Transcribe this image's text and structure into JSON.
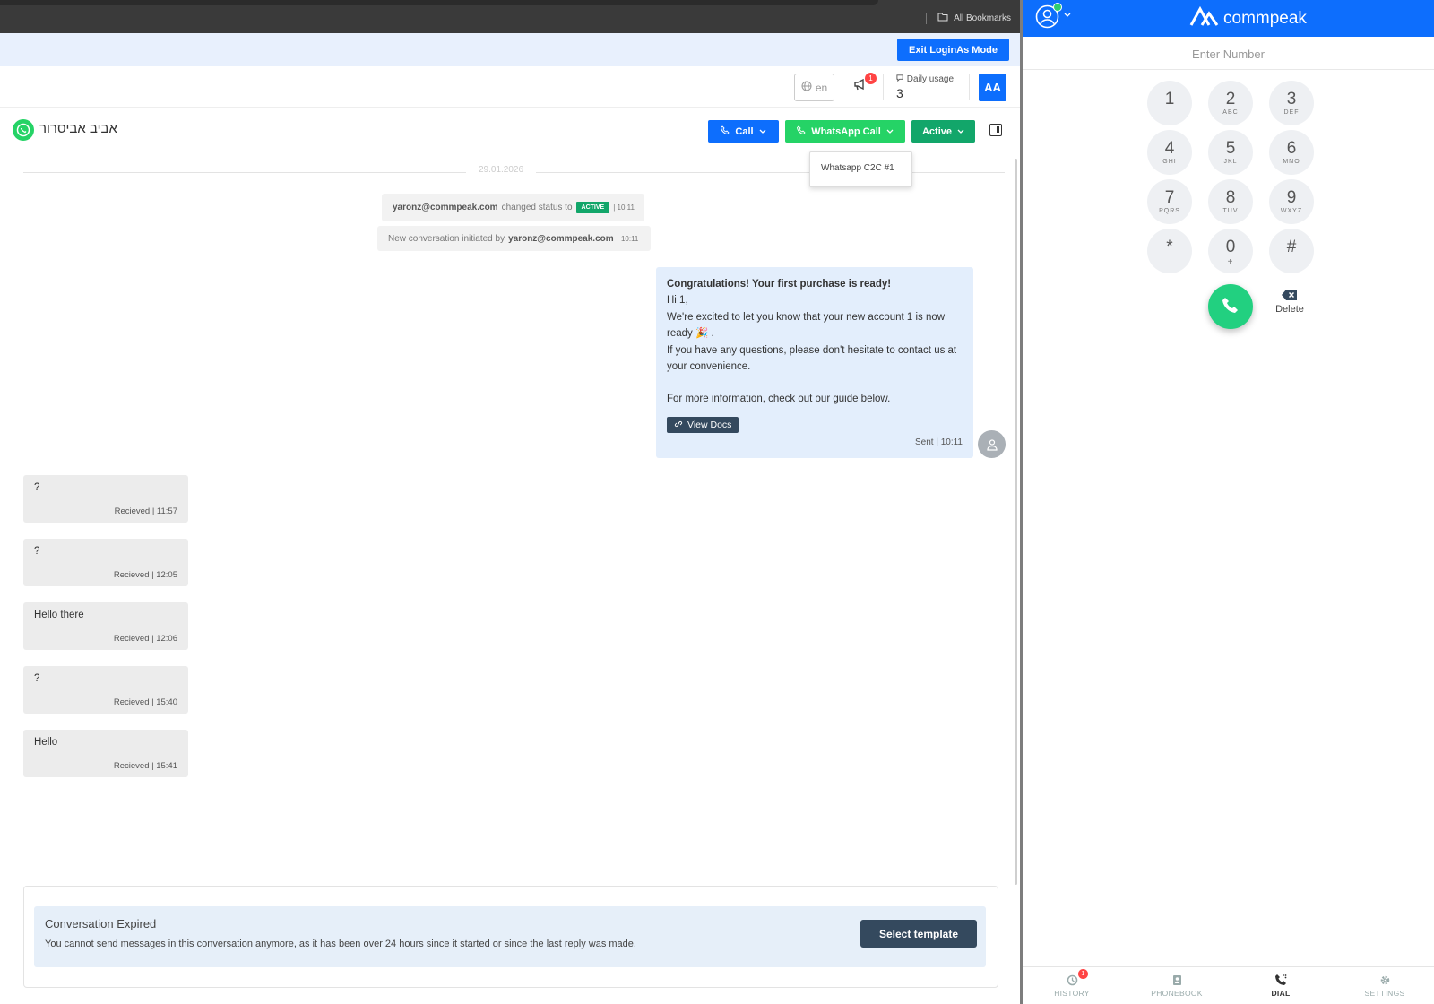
{
  "browser": {
    "bookmarks_label": "All Bookmarks"
  },
  "admin_bar": {
    "exit_label": "Exit LoginAs Mode"
  },
  "topbar": {
    "lang": "en",
    "notification_count": "1",
    "daily_usage_label": "Daily usage",
    "daily_usage_value": "3",
    "user_initials": "AA"
  },
  "conversation": {
    "contact_name": "אביב אביסרור",
    "call_label": "Call",
    "whatsapp_call_label": "WhatsApp Call",
    "status_label": "Active",
    "whatsapp_dropdown_item": "Whatsapp C2C #1",
    "date_divider": "29.01.2026"
  },
  "system_messages": [
    {
      "user": "yaronz@commpeak.com",
      "text": "changed status to",
      "tag": "ACTIVE",
      "time": "| 10:11"
    },
    {
      "prefix": "New conversation initiated by",
      "user": "yaronz@commpeak.com",
      "time": "| 10:11"
    }
  ],
  "outgoing_message": {
    "title": "Congratulations! Your first purchase is ready!",
    "line1": "Hi 1,",
    "line2": "We're excited to let you know that your new account 1 is now ready 🎉 .",
    "line3": "If you have any questions, please don't hesitate to contact us at your convenience.",
    "line4": "For more information, check out our guide below.",
    "button_label": "View Docs",
    "meta": "Sent | 10:11"
  },
  "incoming_messages": [
    {
      "text": "?",
      "meta": "Recieved | 11:57"
    },
    {
      "text": "?",
      "meta": "Recieved | 12:05"
    },
    {
      "text": "Hello there",
      "meta": "Recieved | 12:06"
    },
    {
      "text": "?",
      "meta": "Recieved | 15:40"
    },
    {
      "text": "Hello",
      "meta": "Recieved | 15:41"
    }
  ],
  "expired": {
    "title": "Conversation Expired",
    "text": "You cannot send messages in this conversation anymore, as it has been over 24 hours since it started or since the last reply was made.",
    "button_label": "Select template"
  },
  "dialer": {
    "brand": "commpeak",
    "placeholder": "Enter Number",
    "keys": [
      {
        "digit": "1",
        "letters": ""
      },
      {
        "digit": "2",
        "letters": "ABC"
      },
      {
        "digit": "3",
        "letters": "DEF"
      },
      {
        "digit": "4",
        "letters": "GHI"
      },
      {
        "digit": "5",
        "letters": "JKL"
      },
      {
        "digit": "6",
        "letters": "MNO"
      },
      {
        "digit": "7",
        "letters": "PQRS"
      },
      {
        "digit": "8",
        "letters": "TUV"
      },
      {
        "digit": "9",
        "letters": "WXYZ"
      },
      {
        "digit": "*",
        "letters": ""
      },
      {
        "digit": "0",
        "letters": "+"
      },
      {
        "digit": "#",
        "letters": ""
      }
    ],
    "delete_label": "Delete",
    "nav": {
      "history": "HISTORY",
      "history_badge": "1",
      "phonebook": "PHONEBOOK",
      "dial": "DIAL",
      "settings": "SETTINGS"
    }
  },
  "colors": {
    "primary_blue": "#0d6efd",
    "whatsapp_green": "#25d366",
    "active_green": "#12a66a",
    "dark_button": "#34495e"
  }
}
